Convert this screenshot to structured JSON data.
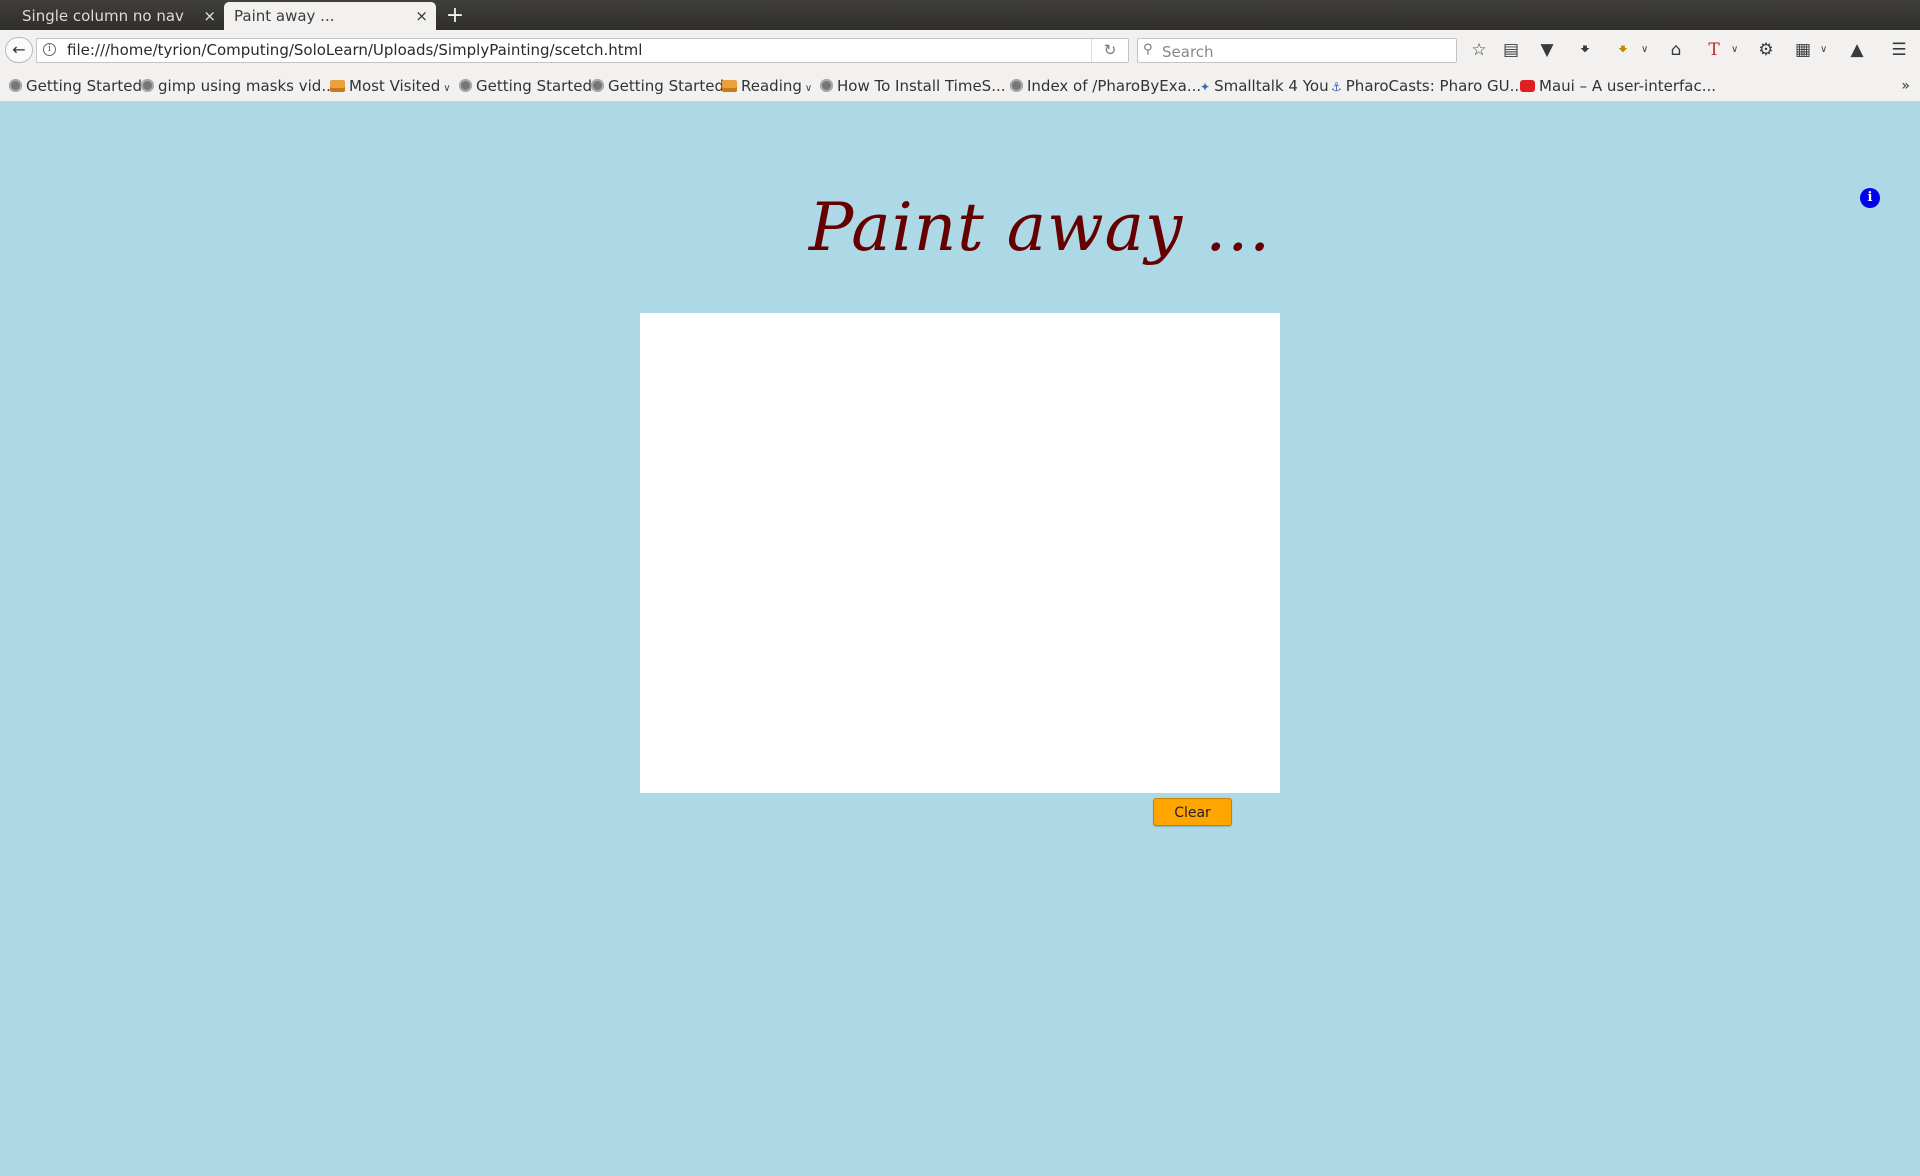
{
  "tabs": [
    {
      "label": "Single column no nav",
      "active": false
    },
    {
      "label": "Paint away ...",
      "active": true
    }
  ],
  "tab_close_glyph": "×",
  "new_tab_glyph": "+",
  "navbar": {
    "url": "file:///home/tyrion/Computing/SoloLearn/Uploads/SimplyPainting/scetch.html",
    "search_placeholder": "Search",
    "toolbar_icons": [
      "bookmark-star-icon",
      "reading-list-icon",
      "pocket-icon",
      "download-icon",
      "download-helper-icon",
      "home-icon",
      "text-tool-icon",
      "extension-icon",
      "clipboard-icon",
      "share-icon",
      "menu-icon"
    ]
  },
  "bookmarks": {
    "items": [
      {
        "label": "Getting Started",
        "icon": "globe"
      },
      {
        "label": "gimp using masks vid...",
        "icon": "globe"
      },
      {
        "label": "Most Visited",
        "icon": "folder",
        "dropdown": true
      },
      {
        "label": "Getting Started",
        "icon": "globe"
      },
      {
        "label": "Getting Started",
        "icon": "globe"
      },
      {
        "label": "Reading",
        "icon": "folder",
        "dropdown": true
      },
      {
        "label": "How To Install TimeS...",
        "icon": "globe"
      },
      {
        "label": "Index of /PharoByExa...",
        "icon": "globe"
      },
      {
        "label": "Smalltalk 4 You",
        "icon": "smalltalk"
      },
      {
        "label": "PharoCasts: Pharo GU...",
        "icon": "pharo"
      },
      {
        "label": "Maui – A user-interfac...",
        "icon": "youtube"
      }
    ],
    "overflow": "»"
  },
  "page": {
    "title": "Paint away ...",
    "clear_label": "Clear",
    "info_glyph": "i",
    "background": "#add8e6",
    "title_color": "#660000",
    "button_color": "#ffa500"
  }
}
